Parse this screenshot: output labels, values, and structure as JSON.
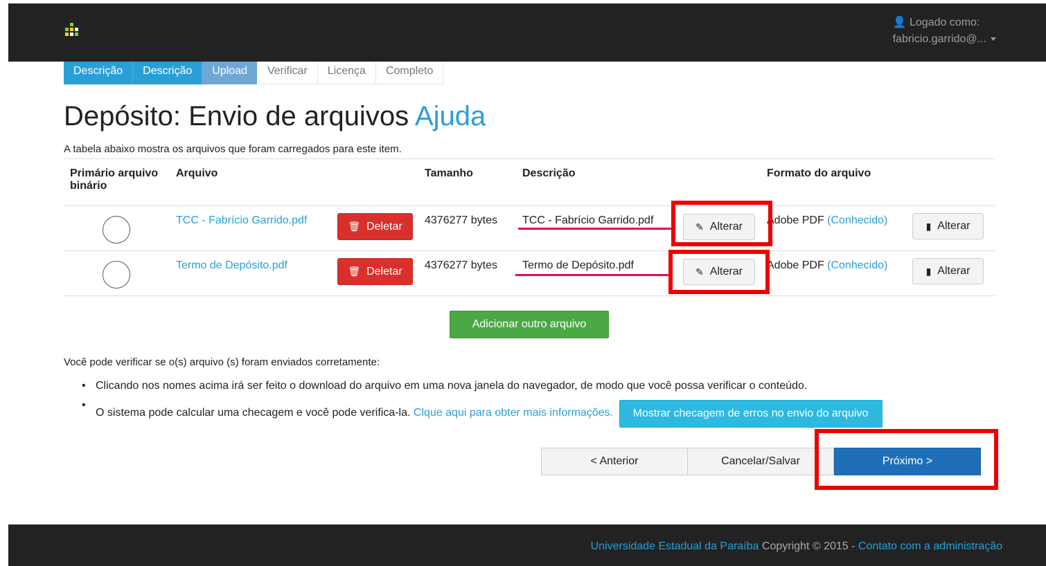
{
  "navbar": {
    "logged_as_label": "Logado como:",
    "user": "fabricio.garrido@...",
    "logo_colors": [
      "#8dc63f",
      "#f7d117",
      "#ffffff"
    ]
  },
  "steps": [
    {
      "label": "Descrição",
      "state": "done"
    },
    {
      "label": "Descrição",
      "state": "done"
    },
    {
      "label": "Upload",
      "state": "active"
    },
    {
      "label": "Verificar",
      "state": "todo"
    },
    {
      "label": "Licença",
      "state": "todo"
    },
    {
      "label": "Completo",
      "state": "todo"
    }
  ],
  "page": {
    "title": "Depósito: Envio de arquivos",
    "help_link": "Ajuda",
    "intro": "A tabela abaixo mostra os arquivos que foram carregados para este item."
  },
  "table": {
    "headers": {
      "primary": "Primário arquivo binário",
      "file": "Arquivo",
      "size": "Tamanho",
      "description": "Descrição",
      "format": "Formato do arquivo"
    },
    "rows": [
      {
        "file": "TCC - Fabrício Garrido.pdf",
        "delete": "Deletar",
        "size": "4376277 bytes",
        "description": "TCC - Fabrício Garrido.pdf",
        "alter": "Alterar",
        "format": "Adobe PDF",
        "format_status": "(Conhecido)",
        "format_alter": "Alterar"
      },
      {
        "file": "Termo de Depósito.pdf",
        "delete": "Deletar",
        "size": "4376277 bytes",
        "description": "Termo de Depósito.pdf",
        "alter": "Alterar",
        "format": "Adobe PDF",
        "format_status": "(Conhecido)",
        "format_alter": "Alterar"
      }
    ]
  },
  "add_file_button": "Adicionar outro arquivo",
  "verify": {
    "text": "Você pode verificar se o(s) arquivo (s) foram enviados corretamente:",
    "bullet1": "Clicando nos nomes acima irá ser feito o download do arquivo em uma nova janela do navegador, de modo que você possa verificar o conteúdo.",
    "bullet2": "O sistema pode calcular uma checagem e você pode verifica-la.",
    "bullet2_link": "Clque aqui para obter mais informações.",
    "checksum_button": "Mostrar checagem de erros no envio do arquivo"
  },
  "pager": {
    "prev": "< Anterior",
    "cancel": "Cancelar/Salvar",
    "next": "Próximo >"
  },
  "footer": {
    "university": "Universidade Estadual da Paraíba",
    "copyright": "Copyright © 2015 -",
    "contact": "Contato com a administração"
  },
  "colors": {
    "navbar": "#222222",
    "primary_link": "#2a9fd6",
    "danger": "#d9302c",
    "success": "#4aa845",
    "info": "#2db9e0",
    "next_button": "#1f6fb8",
    "annotation_red": "#ee0000",
    "annotation_underline": "#e0114c"
  }
}
